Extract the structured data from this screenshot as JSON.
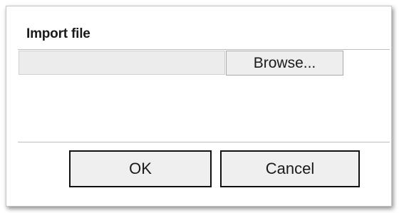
{
  "dialog": {
    "title": "Import file",
    "file_input": {
      "value": "",
      "browse_label": "Browse..."
    },
    "buttons": {
      "ok_label": "OK",
      "cancel_label": "Cancel"
    }
  }
}
